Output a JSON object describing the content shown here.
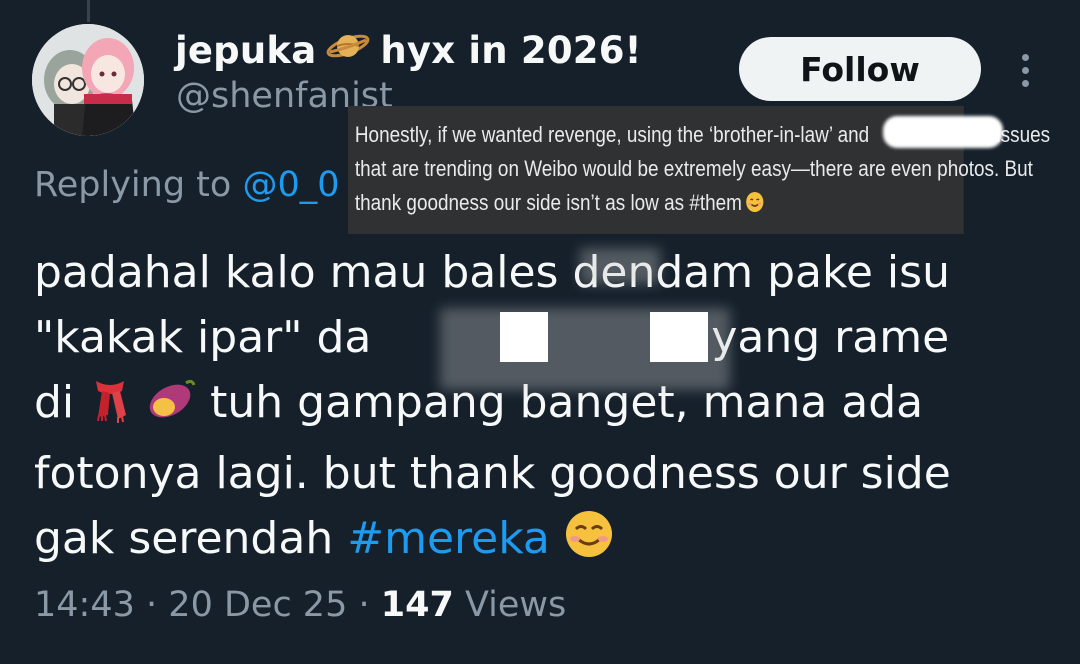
{
  "author": {
    "display_name": "jepuka",
    "display_suffix": "hyx in 2026!",
    "handle": "@shenfanist"
  },
  "follow_label": "Follow",
  "reply": {
    "prefix": "Replying to",
    "mention": "@0_0"
  },
  "translation": {
    "line1": "Honestly, if we wanted revenge, using the ‘brother-in-law’ and",
    "line1_end": "issues",
    "line2": "that are trending on Weibo would be extremely easy—there are even photos. But",
    "line3": "thank goodness our side isn’t as low as #them"
  },
  "tweet": {
    "line1": "padahal kalo mau bales dendam pake isu",
    "line2_start": "\"kakak ipar\" da",
    "line2_end": "yang rame",
    "line3_start": "di",
    "line3_end": "tuh gampang banget, mana ada",
    "line4": "fotonya lagi. but thank goodness our side",
    "line5_start": "gak serendah",
    "hashtag": "#mereka"
  },
  "meta": {
    "time": "14:43",
    "sep1": "·",
    "date": "20 Dec 25",
    "sep2": "·",
    "views": "147",
    "views_label": "Views"
  },
  "colors": {
    "background": "#15202b",
    "link": "#1d9bf0",
    "secondary_text": "#8b98a5"
  },
  "icons": [
    "planet-emoji",
    "scarf-emoji",
    "sweet-potato-emoji",
    "smiling-face-emoji",
    "more-options-icon"
  ]
}
